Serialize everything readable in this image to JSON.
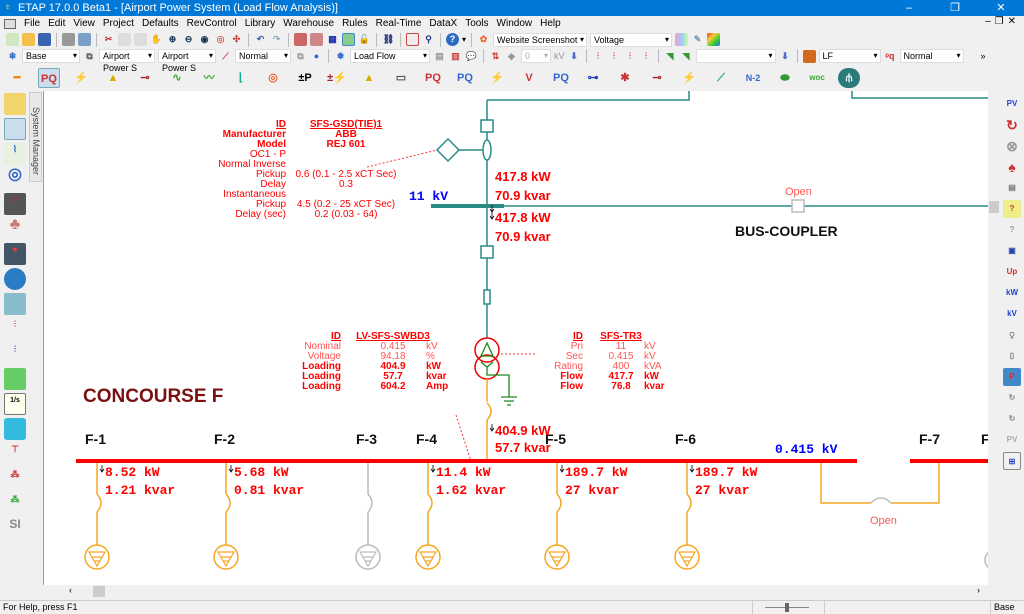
{
  "window": {
    "title": "ETAP 17.0.0 Beta1 - [Airport Power System (Load Flow Analysis)]",
    "minimize": "–",
    "maximize": "❐",
    "close": "✕"
  },
  "menu": [
    "File",
    "Edit",
    "View",
    "Project",
    "Defaults",
    "RevControl",
    "Library",
    "Warehouse",
    "Rules",
    "Real-Time",
    "DataX",
    "Tools",
    "Window",
    "Help"
  ],
  "toolbar1": {
    "website_screenshot": "Website Screenshot",
    "voltage": "Voltage"
  },
  "toolbar2": {
    "base": "Base",
    "config1": "Airport Power S",
    "config2": "Airport Power S",
    "normal": "Normal",
    "study": "Load Flow",
    "kv_value": "0",
    "kv_unit": "kV",
    "lf": "LF",
    "normal2": "Normal"
  },
  "toolbar3": {
    "n2": "N-2"
  },
  "side": {
    "system_manager": "System Manager",
    "si": "SI"
  },
  "diagram": {
    "relay": {
      "labels": [
        "ID",
        "Manufacturer",
        "Model",
        "OC1 - P",
        "Normal Inverse",
        "Pickup",
        "Delay",
        "Instantaneous",
        "Pickup",
        "Delay (sec)"
      ],
      "values": [
        "SFS-GSD(TIE)1",
        "ABB",
        "REJ 601",
        "",
        "",
        "0.6 (0.1 - 2.5  xCT Sec)",
        "0.3",
        "",
        "4.5 (0.2 - 25  xCT Sec)",
        "0.2 (0.03 - 64)"
      ]
    },
    "hv_bus_kv": "11 kV",
    "hv_flow_in": {
      "kw": "417.8 kW",
      "kvar": "70.9 kvar"
    },
    "hv_flow_out": {
      "kw": "417.8 kW",
      "kvar": "70.9 kvar"
    },
    "bus_coupler": {
      "label": "BUS-COUPLER",
      "status": "Open"
    },
    "swbd": {
      "rows": [
        [
          "ID",
          "LV-SFS-SWBD3",
          ""
        ],
        [
          "Nominal",
          "0.415",
          "kV"
        ],
        [
          "Voltage",
          "94.18",
          "%"
        ],
        [
          "Loading",
          "404.9",
          "kW"
        ],
        [
          "Loading",
          "57.7",
          "kvar"
        ],
        [
          "Loading",
          "604.2",
          "Amp"
        ]
      ]
    },
    "tr": {
      "rows": [
        [
          "ID",
          "SFS-TR3",
          ""
        ],
        [
          "Pri",
          "11",
          "kV"
        ],
        [
          "Sec",
          "0.415",
          "kV"
        ],
        [
          "Rating",
          "400",
          "kVA"
        ],
        [
          "Flow",
          "417.7",
          "kW"
        ],
        [
          "Flow",
          "76.8",
          "kvar"
        ]
      ]
    },
    "area_label": "CONCOURSE F",
    "lv_flow": {
      "kw": "404.9 kW",
      "kvar": "57.7 kvar"
    },
    "lv_bus_kv": "0.415 kV",
    "feeders": [
      {
        "name": "F-1",
        "kw": "8.52 kW",
        "kvar": "1.21 kvar",
        "energized": true
      },
      {
        "name": "F-2",
        "kw": "5.68 kW",
        "kvar": "0.81 kvar",
        "energized": true
      },
      {
        "name": "F-3",
        "kw": "",
        "kvar": "",
        "energized": false
      },
      {
        "name": "F-4",
        "kw": "11.4 kW",
        "kvar": "1.62 kvar",
        "energized": true
      },
      {
        "name": "F-5",
        "kw": "189.7 kW",
        "kvar": "27 kvar",
        "energized": true
      },
      {
        "name": "F-6",
        "kw": "189.7 kW",
        "kvar": "27 kvar",
        "energized": true
      }
    ],
    "f7": "F-7",
    "f8": "F",
    "tie_status": "Open"
  },
  "status": {
    "help": "For Help, press F1",
    "mode": "Base"
  },
  "colors": {
    "teal": "#2a8a85",
    "red": "#ff0000",
    "orange": "#f5a623",
    "blue": "#0000ff",
    "dark_red": "#7a1010",
    "gray": "#bbbbbb"
  }
}
